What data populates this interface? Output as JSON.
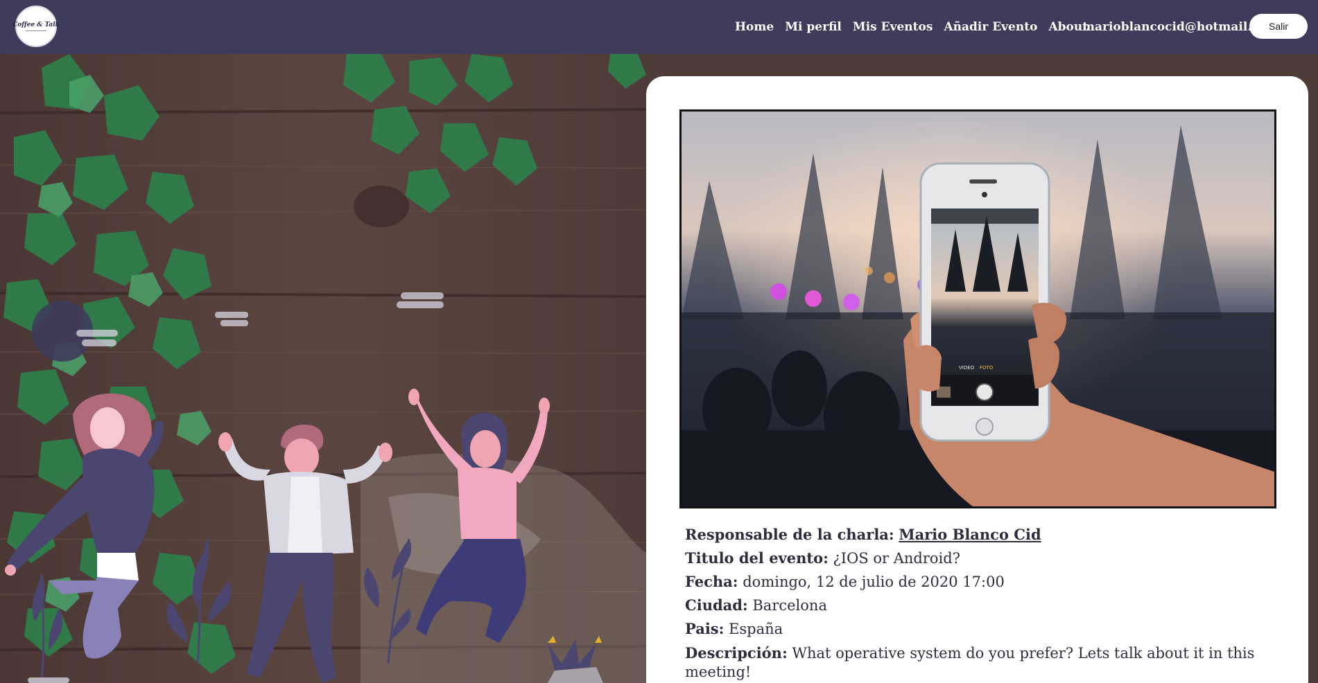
{
  "navbar": {
    "logo_text": "Coffee & Talk",
    "links": [
      "Home",
      "Mi perfil",
      "Mis Eventos",
      "Añadir Evento",
      "About"
    ],
    "user_email": "marioblancocid@hotmail.es",
    "logout_label": "Salir"
  },
  "event": {
    "owner_label": "Responsable de la charla:",
    "owner_name": "Mario Blanco Cid",
    "title_label": "Titulo del evento:",
    "title": "¿IOS or Android?",
    "date_label": "Fecha:",
    "date": "domingo, 12 de julio de 2020 17:00",
    "city_label": "Ciudad:",
    "city": "Barcelona",
    "country_label": "Pais:",
    "country": "España",
    "description_label": "Descripción:",
    "description": "What operative system do you prefer? Lets talk about it in this meeting!"
  },
  "photo": {
    "camera_modes": [
      "VIDEO",
      "FOTO"
    ]
  },
  "colors": {
    "navbar": "#3e3c5a",
    "card": "#ffffff",
    "text": "#2d2d3d",
    "wood": "#5a4540",
    "ivy": "#2f7d4a"
  }
}
